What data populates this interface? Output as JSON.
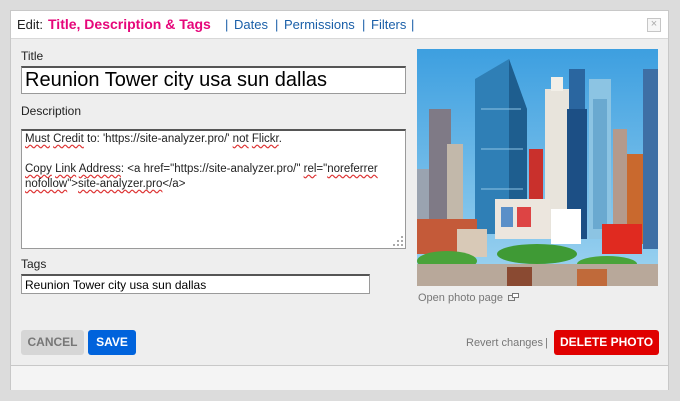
{
  "tabs": {
    "edit_label": "Edit:",
    "active": "Title, Description & Tags",
    "separator": "|",
    "dates": "Dates",
    "permissions": "Permissions",
    "filters": "Filters",
    "close_glyph": "×"
  },
  "form": {
    "title_label": "Title",
    "title_value": "Reunion Tower city usa sun dallas",
    "description_label": "Description",
    "description_lines": [
      "Must Credit to: 'https://site-analyzer.pro/' not Flickr.",
      "",
      "Copy Link Address: <a href=\"https://site-analyzer.pro/\" rel=\"noreferrer",
      "nofollow\">site-analyzer.pro</a>"
    ],
    "tags_label": "Tags",
    "tags_value": "Reunion Tower city usa sun dallas"
  },
  "photo": {
    "open_label": "Open photo page",
    "open_icon": "external-window-icon"
  },
  "actions": {
    "cancel": "CANCEL",
    "save": "SAVE",
    "revert": "Revert changes",
    "revert_sep": "|",
    "delete": "DELETE PHOTO"
  },
  "colors": {
    "active_tab": "#e6067a",
    "link": "#1a5fa8",
    "save_bg": "#0063dc",
    "delete_bg": "#e00000",
    "cancel_bg": "#d6d6d6"
  }
}
